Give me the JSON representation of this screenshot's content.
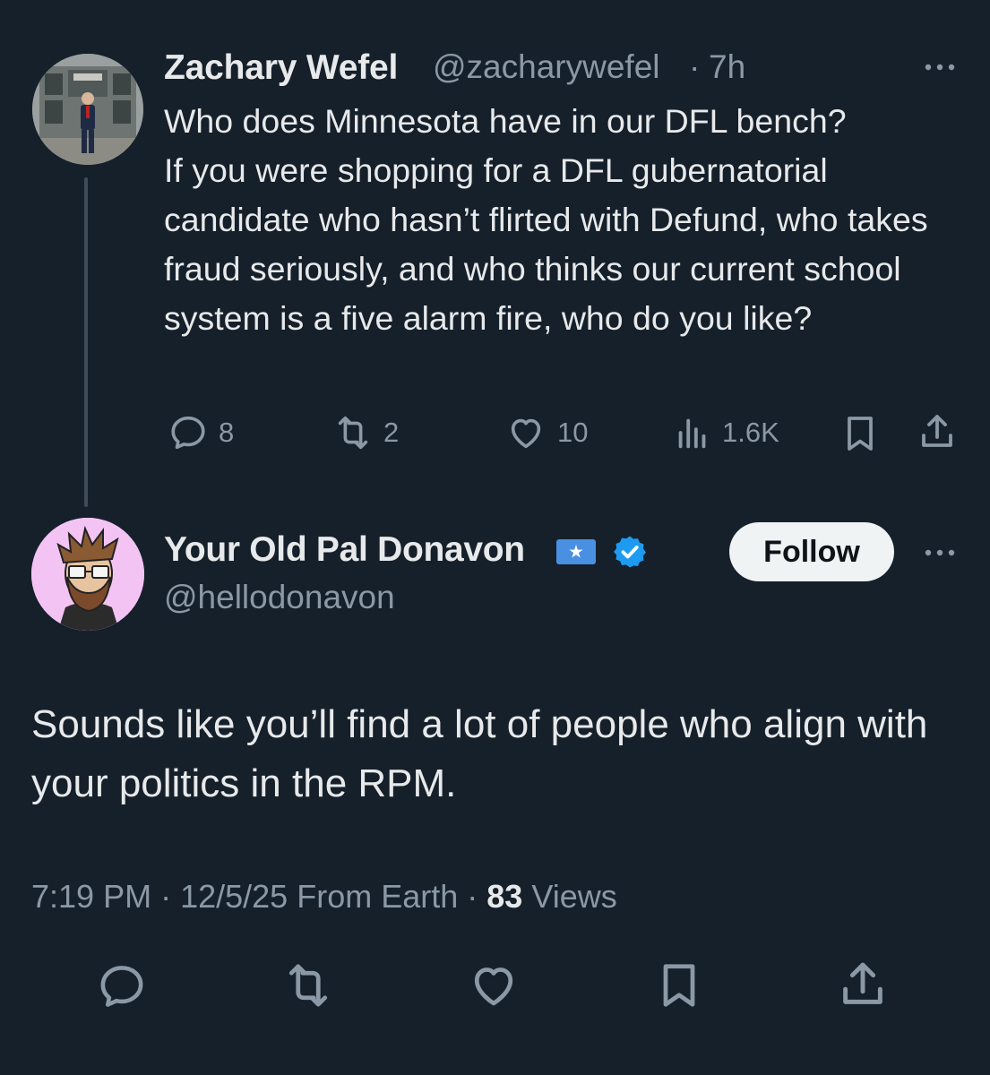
{
  "parent_tweet": {
    "author_name": "Zachary Wefel",
    "handle": "@zacharywefel",
    "separator": "·",
    "time": "7h",
    "text": "Who does Minnesota have in our DFL bench?\nIf you were shopping for a DFL gubernatorial candidate who hasn’t flirted with Defund, who takes fraud seriously, and who thinks our current school system is a five alarm fire, who do you like?",
    "replies": "8",
    "reposts": "2",
    "likes": "10",
    "views": "1.6K"
  },
  "reply_tweet": {
    "author_name": "Your Old Pal Donavon",
    "handle": "@hellodonavon",
    "follow_label": "Follow",
    "text": "Sounds like you’ll find a lot of people who align with your politics in the RPM.",
    "time": "7:19 PM",
    "date": "12/5/25",
    "source": "From Earth",
    "views_count": "83",
    "views_label": "Views",
    "sep1": " · ",
    "sep2": " · "
  },
  "icons": {
    "more": "more-icon",
    "reply": "reply-icon",
    "repost": "repost-icon",
    "like": "heart-icon",
    "views": "views-icon",
    "bookmark": "bookmark-icon",
    "share": "share-icon",
    "verified": "verified-badge-icon",
    "flag": "somalia-flag-icon"
  },
  "colors": {
    "background": "#15202b",
    "text_primary": "#e7e9ea",
    "text_secondary": "#8b98a5",
    "verified_blue": "#1d9bf0",
    "follow_bg": "#eff3f4",
    "thread_line": "#3e4c59"
  }
}
